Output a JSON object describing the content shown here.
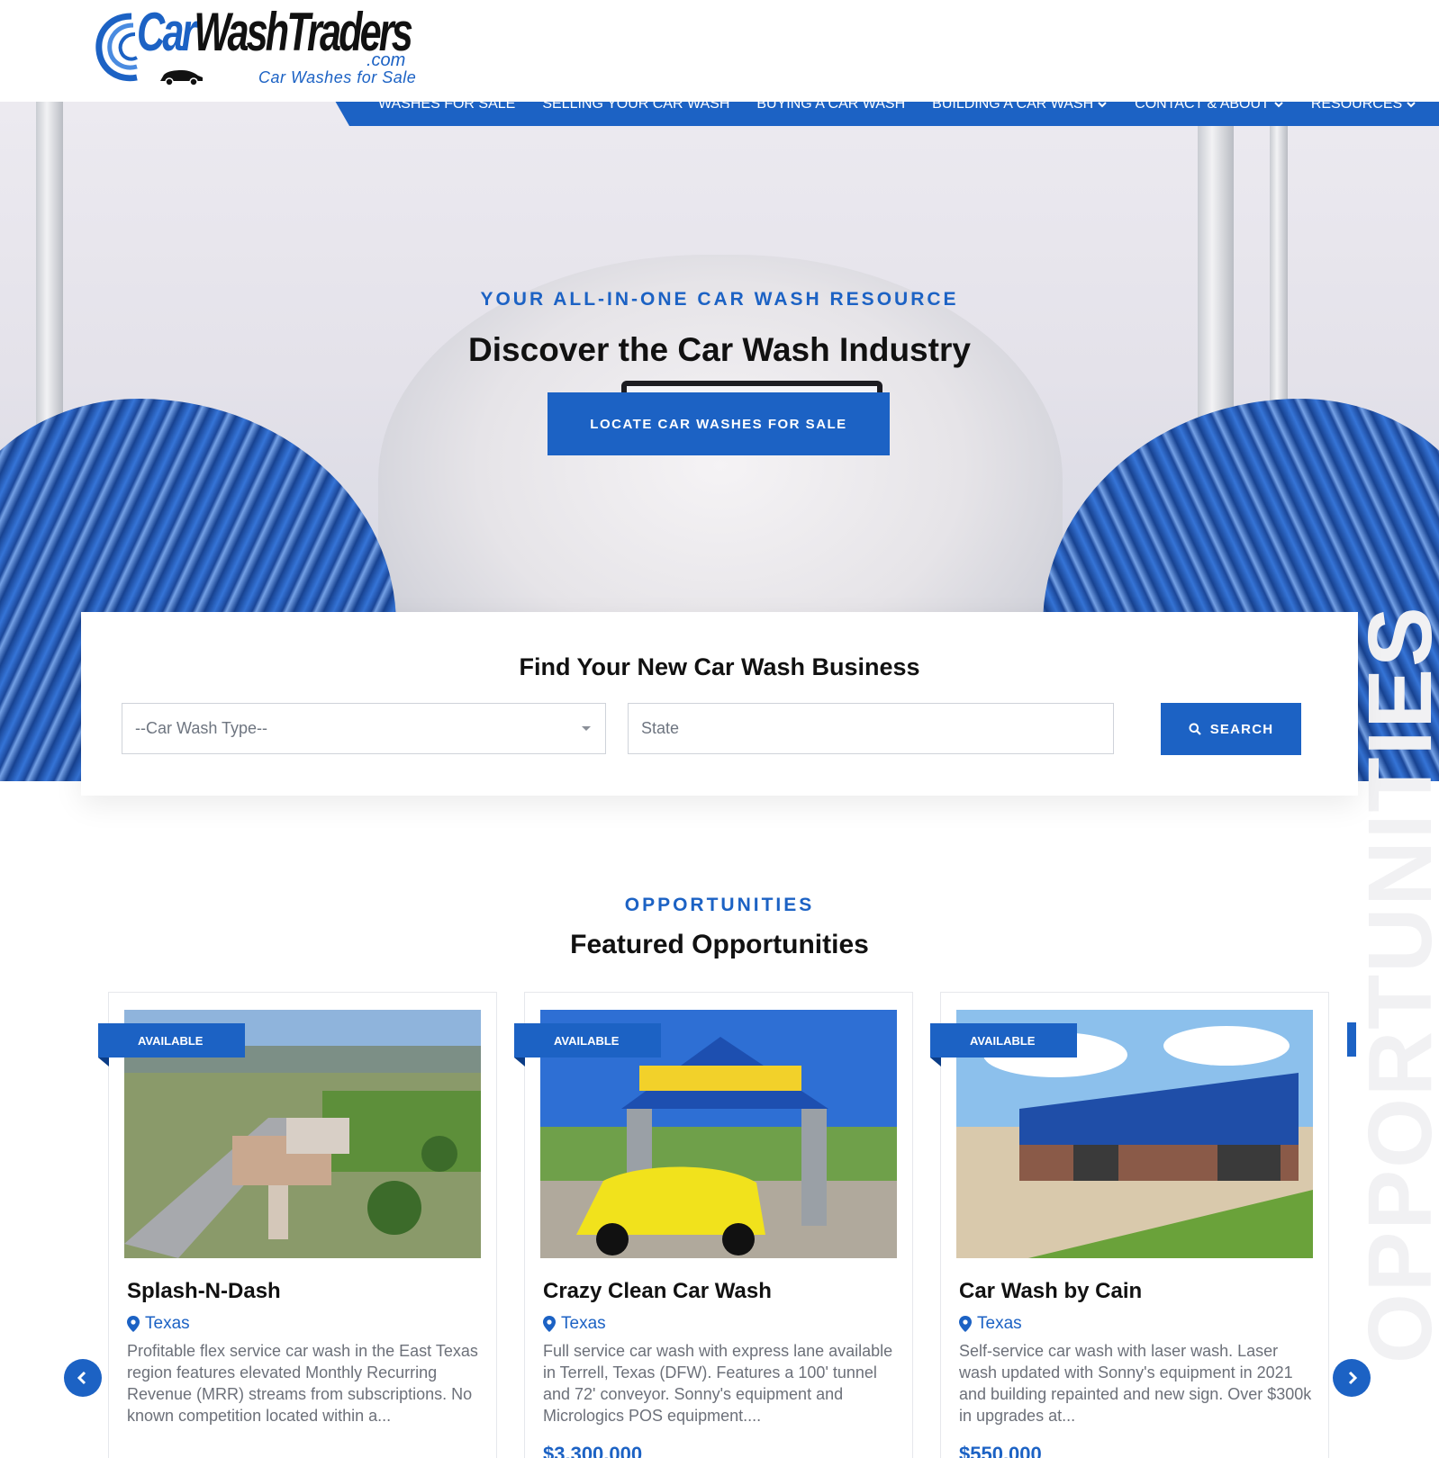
{
  "brand": {
    "logo_word_car": "Car",
    "logo_word_rest": "WashTraders",
    "logo_dotcom": ".com",
    "logo_tagline": "Car Washes for Sale"
  },
  "nav": {
    "items": [
      {
        "label": "WASHES FOR SALE",
        "dropdown": false
      },
      {
        "label": "SELLING YOUR CAR WASH",
        "dropdown": false
      },
      {
        "label": "BUYING A CAR WASH",
        "dropdown": false
      },
      {
        "label": "BUILDING A CAR WASH",
        "dropdown": true
      },
      {
        "label": "CONTACT & ABOUT",
        "dropdown": true
      },
      {
        "label": "RESOURCES",
        "dropdown": true
      }
    ]
  },
  "hero": {
    "eyebrow": "YOUR ALL-IN-ONE CAR WASH RESOURCE",
    "title": "Discover the Car Wash Industry",
    "cta_label": "LOCATE CAR WASHES FOR SALE"
  },
  "search": {
    "title": "Find Your New Car Wash Business",
    "type_placeholder": "--Car Wash Type--",
    "state_placeholder": "State",
    "button_label": "SEARCH"
  },
  "opportunities": {
    "eyebrow": "OPPORTUNITIES",
    "title": "Featured Opportunities",
    "watermark": "OPPORTUNITIES",
    "cards": [
      {
        "badge": "AVAILABLE",
        "name": "Splash-N-Dash",
        "location": "Texas",
        "description": "Profitable flex service car wash in the East Texas region features elevated Monthly Recurring Revenue (MRR) streams from subscriptions. No known competition located within a...",
        "price": ""
      },
      {
        "badge": "AVAILABLE",
        "name": "Crazy Clean Car Wash",
        "location": "Texas",
        "description": "Full service car wash with express lane available in Terrell, Texas (DFW). Features a 100' tunnel and 72' conveyor. Sonny's equipment and Micrologics POS equipment....",
        "price": "$3,300,000"
      },
      {
        "badge": "AVAILABLE",
        "name": "Car Wash by Cain",
        "location": "Texas",
        "description": "Self-service car wash with laser wash. Laser wash updated with Sonny's equipment in 2021 and building repainted and new sign. Over $300k in upgrades at...",
        "price": "$550,000"
      }
    ]
  },
  "colors": {
    "brand_blue": "#1c62c4",
    "text_dark": "#111111",
    "text_muted": "#6c7079"
  },
  "icons": {
    "nav_dropdown": "chevron-down-icon",
    "search": "search-icon",
    "location": "map-pin-icon",
    "prev": "chevron-left-icon",
    "next": "chevron-right-icon"
  }
}
